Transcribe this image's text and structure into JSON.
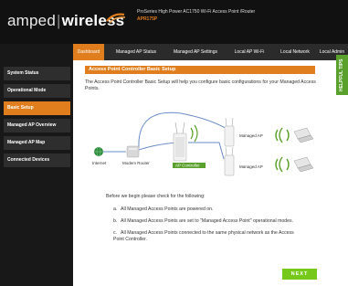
{
  "brand": {
    "name_part1": "amped",
    "name_part2": "wireless"
  },
  "product": {
    "title": "ProSeries High Power AC1750 Wi-Fi Access Point /Router",
    "model": "APR175P"
  },
  "nav": {
    "tabs": [
      {
        "label": "Dashboard",
        "active": true
      },
      {
        "label": "Managed AP Status",
        "active": false
      },
      {
        "label": "Managed AP Settings",
        "active": false
      },
      {
        "label": "Local AP Wi-Fi",
        "active": false
      },
      {
        "label": "Local Network",
        "active": false
      },
      {
        "label": "Local Admin",
        "active": false
      }
    ]
  },
  "sidebar": {
    "items": [
      {
        "label": "System Status",
        "active": false
      },
      {
        "label": "Operational Mode",
        "active": false
      },
      {
        "label": "Basic Setup",
        "active": true
      },
      {
        "label": "Managed AP Overview",
        "active": false
      },
      {
        "label": "Managed AP Map",
        "active": false
      },
      {
        "label": "Connected Devices",
        "active": false
      }
    ]
  },
  "tips": {
    "label": "HELPFUL TIPS"
  },
  "section": {
    "title": "Access Point Controller Basic Setup",
    "intro": "The Access Point Controller Basic Setup will help you configure basic configurations for your Managed Access Points."
  },
  "diagram": {
    "internet": "Internet",
    "modem": "Modem Router",
    "controller": "AP Controller",
    "managed_ap_1": "Managed AP",
    "managed_ap_2": "Managed AP"
  },
  "checklist": {
    "intro": "Before we begin please check for the following:",
    "items": [
      {
        "letter": "a.",
        "text": "All Managed Access Points are powered on."
      },
      {
        "letter": "b.",
        "text": "All Managed Access Points are set to \"Managed Access Point\" operational modes."
      },
      {
        "letter": "c.",
        "text": "All Managed Access Points connected to the same physical network as the Access Point Controller."
      }
    ]
  },
  "actions": {
    "next": "NEXT"
  },
  "colors": {
    "accent": "#e07d1c",
    "green": "#76c81a",
    "sidebar_bg": "#181818",
    "header_bg": "#111111"
  }
}
